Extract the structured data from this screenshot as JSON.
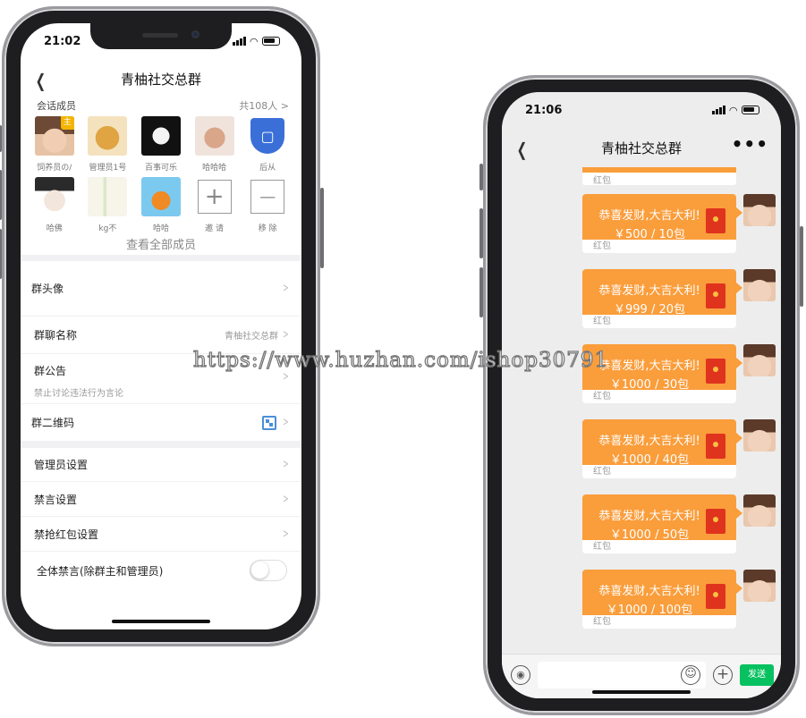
{
  "left_phone": {
    "status_time": "21:02",
    "title": "青柚社交总群",
    "members_label": "会话成员",
    "members_count": "共108人 >",
    "members": [
      {
        "name": "饲养员の/",
        "badge": "主"
      },
      {
        "name": "管理员1号"
      },
      {
        "name": "百事可乐"
      },
      {
        "name": "哈哈哈"
      },
      {
        "name": "后从"
      },
      {
        "name": "哈佛"
      },
      {
        "name": "kg不"
      },
      {
        "name": "哈哈"
      },
      {
        "name": "邀 请"
      },
      {
        "name": "移 除"
      }
    ],
    "add_symbol": "+",
    "remove_symbol": "—",
    "view_all": "查看全部成员",
    "rows": {
      "avatar": "群头像",
      "group_name": "群聊名称",
      "group_name_value": "青柚社交总群",
      "notice": "群公告",
      "notice_sub": "禁止讨论违法行为言论",
      "qrcode": "群二维码",
      "admin": "管理员设置",
      "mute": "禁言设置",
      "no_grab": "禁抢红包设置",
      "mute_all": "全体禁言(除群主和管理员)"
    },
    "chevron": ">"
  },
  "right_phone": {
    "status_time": "21:06",
    "title": "青柚社交总群",
    "more": "•••",
    "back": "<",
    "top_cut_label": "红包",
    "messages": [
      {
        "wish": "恭喜发财,大吉大利!",
        "amount": "￥500 / 10包",
        "footer": "红包"
      },
      {
        "wish": "恭喜发财,大吉大利!",
        "amount": "￥999 / 20包",
        "footer": "红包"
      },
      {
        "wish": "恭喜发财,大吉大利!",
        "amount": "￥1000 / 30包",
        "footer": "红包"
      },
      {
        "wish": "恭喜发财,大吉大利!",
        "amount": "￥1000 / 40包",
        "footer": "红包"
      },
      {
        "wish": "恭喜发财,大吉大利!",
        "amount": "￥1000 / 50包",
        "footer": "红包"
      },
      {
        "wish": "恭喜发财,大吉大利!",
        "amount": "￥1000 / 100包",
        "footer": "红包"
      }
    ],
    "send_label": "发送",
    "voice_glyph": "◉",
    "emoji_glyph": "☺",
    "plus_glyph": "+"
  },
  "watermark": "https://www.huzhan.com/ishop30791",
  "colors": {
    "packet": "#fa9d3b",
    "send": "#07c160",
    "shield": "#3b6fd8",
    "qr": "#4a8fd9"
  },
  "icons": [
    "back-icon",
    "chevron-right-icon",
    "qrcode-icon",
    "shield-icon",
    "red-envelope-icon",
    "voice-icon",
    "emoji-icon",
    "plus-icon",
    "more-icon"
  ]
}
